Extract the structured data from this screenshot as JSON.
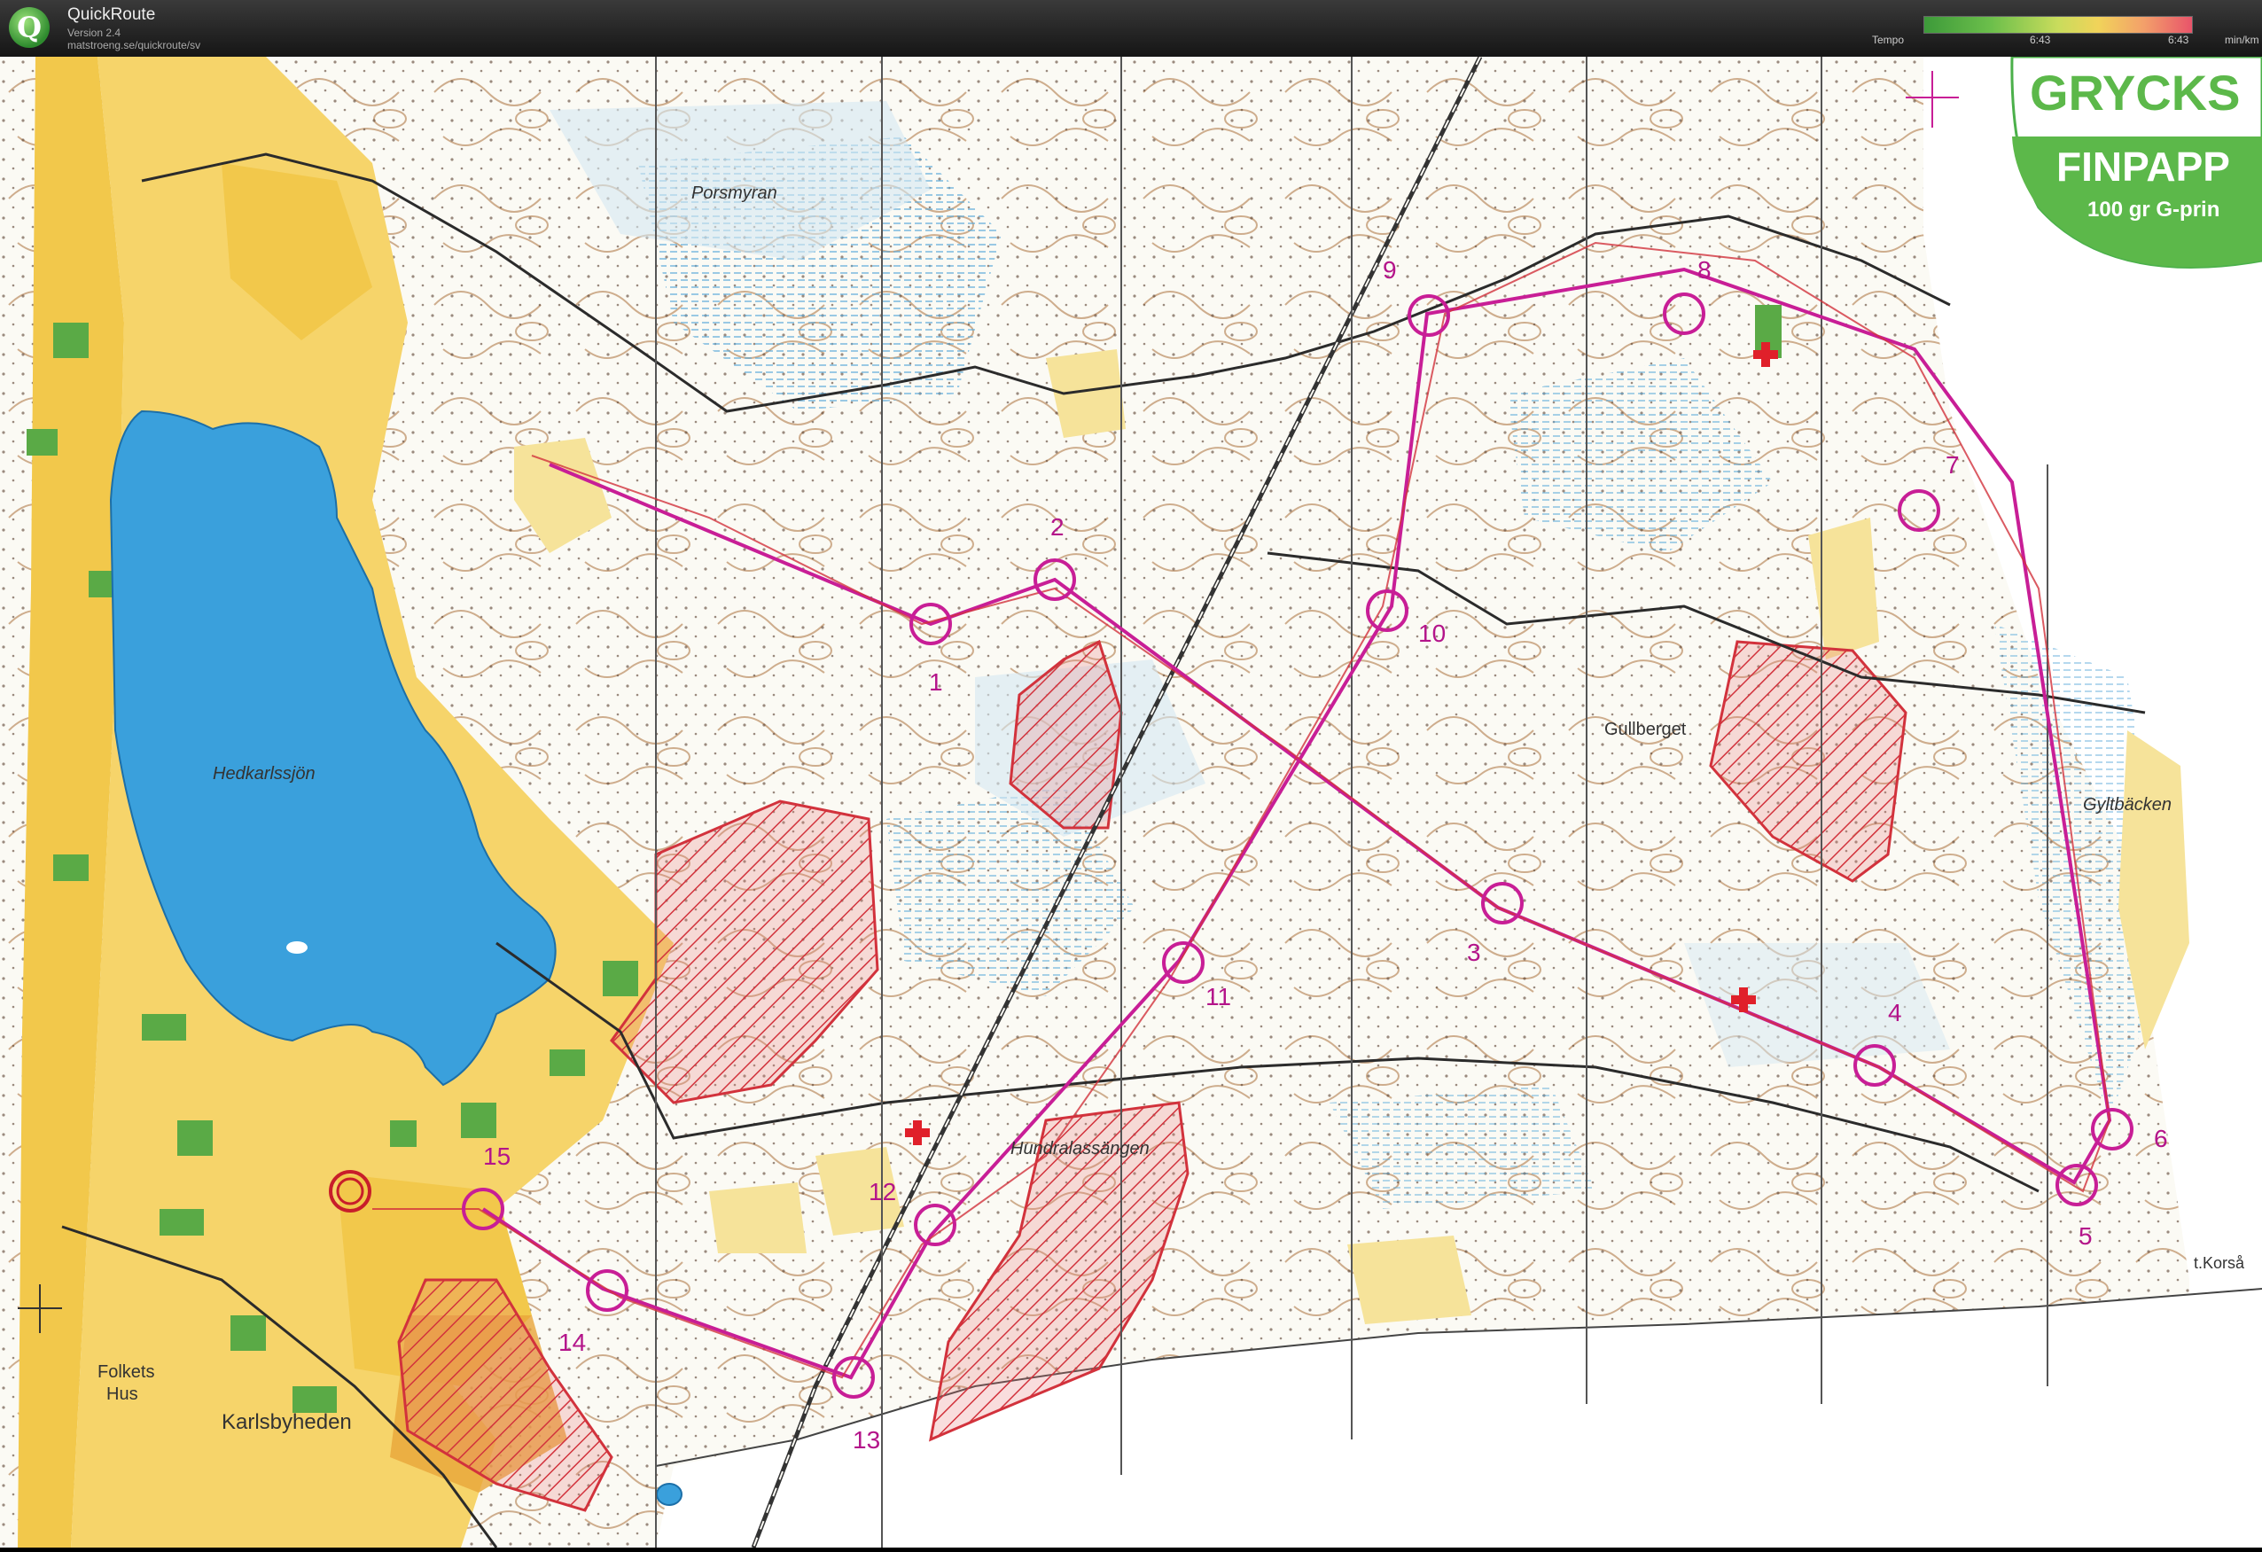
{
  "app": {
    "name": "QuickRoute",
    "version": "Version 2.4",
    "url": "matstroeng.se/quickroute/sv"
  },
  "tempo": {
    "label": "Tempo",
    "value_left": "6:43",
    "value_right": "6:43",
    "unit": "min/km"
  },
  "map": {
    "title_lines": [
      "GRYCKS",
      "FINPAPP",
      "100 gr G-prin"
    ],
    "places": {
      "lake": "Hedkarlssjön",
      "porsmyran": "Porsmyran",
      "gullberget": "Gullberget",
      "gyltbacken": "Gyltbäcken",
      "hundralassangen": "Hundralassängen",
      "karlsbyheden": "Karlsbyheden",
      "folkets": "Folkets",
      "hus": "Hus",
      "korsa": "t.Korså"
    },
    "controls": [
      "1",
      "2",
      "3",
      "4",
      "5",
      "6",
      "7",
      "8",
      "9",
      "10",
      "11",
      "12",
      "13",
      "14",
      "15"
    ],
    "colors": {
      "course": "#c81e96",
      "lake": "#3aa0dc",
      "open_land": "#f2c84b",
      "forbidden": "#d2323c",
      "green": "#4a9a3a",
      "contour": "#b07a50"
    }
  }
}
